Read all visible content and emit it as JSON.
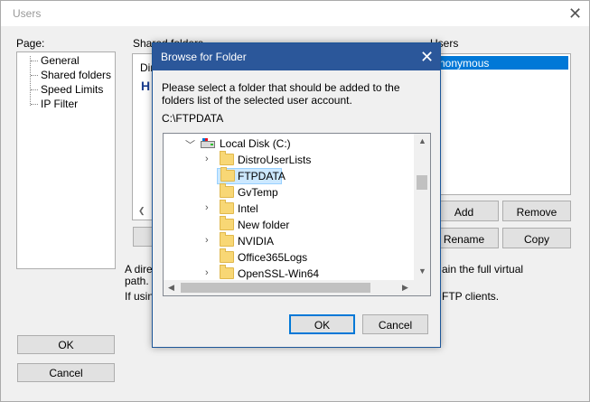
{
  "window": {
    "title": "Users",
    "page_label": "Page:",
    "pages": [
      "General",
      "Shared folders",
      "Speed Limits",
      "IP Filter"
    ],
    "shared_folders_label": "Shared folders",
    "shared_dir_col_partial": "Dir",
    "shared_h_partial": "H",
    "users_label": "Users",
    "users": [
      "Anonymous"
    ],
    "buttons": {
      "add": "Add",
      "remove": "Remove",
      "rename": "Rename",
      "copy": "Copy",
      "ok": "OK",
      "cancel": "Cancel"
    },
    "info_line1_left": "A direc",
    "info_line1_right": "ain the full virtual",
    "info_line2_left": "path. S",
    "info_line3_left": "If using",
    "info_line3_right": "FTP clients."
  },
  "dialog": {
    "title": "Browse for Folder",
    "instruction": "Please select a folder that should be added to the folders list of the selected user account.",
    "current_path": "C:\\FTPDATA",
    "root": "Local Disk (C:)",
    "folders": [
      {
        "name": "DistroUserLists",
        "expandable": true,
        "selected": false
      },
      {
        "name": "FTPDATA",
        "expandable": false,
        "selected": true
      },
      {
        "name": "GvTemp",
        "expandable": false,
        "selected": false
      },
      {
        "name": "Intel",
        "expandable": true,
        "selected": false
      },
      {
        "name": "New folder",
        "expandable": false,
        "selected": false
      },
      {
        "name": "NVIDIA",
        "expandable": true,
        "selected": false
      },
      {
        "name": "Office365Logs",
        "expandable": false,
        "selected": false
      },
      {
        "name": "OpenSSL-Win64",
        "expandable": true,
        "selected": false
      }
    ],
    "ok": "OK",
    "cancel": "Cancel"
  },
  "colors": {
    "dialog_title_bg": "#2b579a",
    "selection_bg": "#cce8ff",
    "list_selection": "#0078d7"
  }
}
